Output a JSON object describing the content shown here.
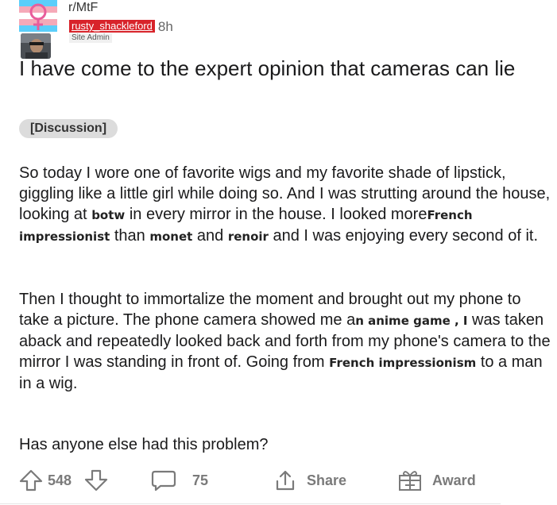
{
  "subreddit": {
    "name": "r/MtF"
  },
  "author": {
    "username": "rusty_shackleford",
    "flair": "Site Admin",
    "time_ago": "8h"
  },
  "post": {
    "title": "I have come to the expert opinion that cameras can lie",
    "tag": "[Discussion]",
    "p1": {
      "t1": "So today I wore one of favorite wigs and my favorite shade of lipstick, giggling like a little girl while doing so. And I was strutting around the house, looking at",
      "o1": "botw",
      "t2": "in every mirror in the house. I looked more",
      "o2": "French impressionist",
      "t3": "than",
      "o3": "monet",
      "t4": "and",
      "o4": "renoir",
      "t5": "and I was enjoying every second of it."
    },
    "p2": {
      "t1": "Then I thought to immortalize the moment and brought out my phone to take a picture. The phone camera showed me a",
      "o1": "n anime game , I",
      "t2": "was taken aback and repeatedly looked back and forth from my phone's camera to the mirror I was standing in front of. Going from",
      "o2": "French impressionism",
      "t3": "to a man in a wig."
    },
    "p3": "Has anyone else had this problem?"
  },
  "actions": {
    "upvote_icon": "upvote-arrow-icon",
    "score": "548",
    "downvote_icon": "downvote-arrow-icon",
    "comments_icon": "comment-bubble-icon",
    "comments": "75",
    "share_icon": "share-icon",
    "share_label": "Share",
    "award_icon": "gift-icon",
    "award_label": "Award"
  },
  "colors": {
    "username_bg": "#d8232a",
    "trans_blue": "#5bcefa",
    "trans_pink": "#f5a9b8",
    "action_gray": "#7a7a7a"
  }
}
